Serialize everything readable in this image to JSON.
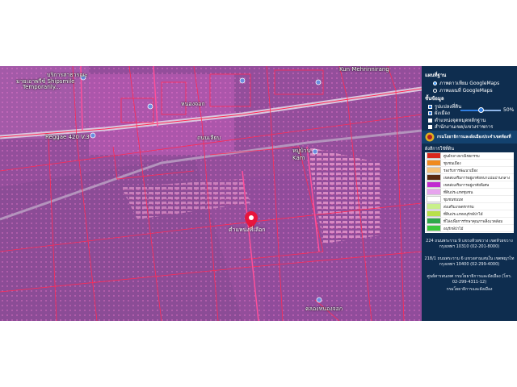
{
  "map": {
    "labels": {
      "top_left": "บริการสาธารณะ",
      "shipsmile": "มายเอาพรีซ์ Shipsmile",
      "temporarily": "Temporarily...",
      "reggae": "Reggae 420 V.3",
      "nong_chok": "หนองจอก",
      "kam": "Kam",
      "khlong": "คลอง",
      "road_center": "ถนนเลียบ",
      "bottom_right": "คลองหนองจอก",
      "top_right": "Kun Mehrinnirang",
      "right_mid": "หมู่บ้าน"
    },
    "marker_label": "ตำแหน่งที่เลือก",
    "colors": {
      "overlay": "#c44fc4",
      "boundary": "#ff2a55",
      "marker": "#e8153d"
    }
  },
  "panel": {
    "basemap_heading": "แผนที่ฐาน",
    "basemap_options": [
      {
        "label": "ภาพดาวเทียม GoogleMaps",
        "selected": true
      },
      {
        "label": "ภาพแผนที่ GoogleMaps",
        "selected": false
      }
    ],
    "layers_heading": "ชั้นข้อมูล",
    "layers": [
      {
        "label": "รูปแปลงที่ดิน",
        "checked": true
      },
      {
        "label": "ผังเมือง",
        "checked": true
      },
      {
        "label": "ตำแหน่งจุดหมุดหลักฐาน",
        "checked": false
      },
      {
        "label": "สำนักงานเขต/แขวงราชการ",
        "checked": false
      }
    ],
    "opacity_percent": 50,
    "opacity_text": "50%",
    "banner_text": "กรมโยธาธิการและผังเมืองประจำเขตท้องที่",
    "legend_heading": "ผังสีการใช้ที่ดิน",
    "legend": [
      {
        "label": "ศูนย์กลางพาณิชยกรรม",
        "color": "#d9261c"
      },
      {
        "label": "ชุมชนเมือง",
        "color": "#f08a1e"
      },
      {
        "label": "รองรับการพัฒนาเมือง",
        "color": "#f5c27a"
      },
      {
        "label": "เขตส่งเสริมการอยู่อาศัยหนาแน่นปานกลาง",
        "color": "#5b2a10"
      },
      {
        "label": "เขตส่งเสริมการอยู่อาศัยพิเศษ",
        "color": "#c02ad0"
      },
      {
        "label": "ที่ดินประเภทชุมชน",
        "color": "#e7a4ee"
      },
      {
        "label": "ชุมชนชนบท",
        "color": "#ffffff"
      },
      {
        "label": "ส่งเสริมเกษตรกรรม",
        "color": "#c8f08a"
      },
      {
        "label": "ที่ดินประเภทอนุรักษ์ป่าไม้",
        "color": "#b8e04a"
      },
      {
        "label": "ที่โล่งเพื่อการรักษาคุณภาพสิ่งแวดล้อม",
        "color": "#2ea84a"
      },
      {
        "label": "อนุรักษ์ป่าไม้",
        "color": "#3cc83c"
      }
    ],
    "address_1": "224 ถนนพระราม 9 แขวงห้วยขวาง เขตห้วยขวาง กรุงเทพฯ 10310 (02-201-8000)",
    "address_2": "218/1 ถนนพระราม 6 แขวงสามเสนใน เขตพญาไท กรุงเทพฯ 10400 (02-299-4000)",
    "address_3": "ศูนย์สารสนเทศ กรมโยธาธิการและผังเมือง (โทร. 02-299-4311-12)",
    "address_4": "กรมโยธาธิการและผังเมือง"
  }
}
